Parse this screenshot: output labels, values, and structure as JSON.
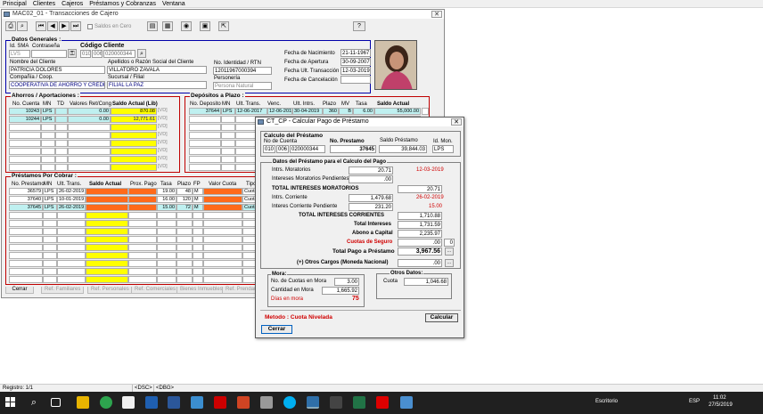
{
  "menu": [
    "Principal",
    "Clientes",
    "Cajeros",
    "Préstamos y Cobranzas",
    "Ventana"
  ],
  "main_window": {
    "title": "MAC02_01 - Transacciones de Cajero",
    "saldos_checkbox": "Saldos en Cero",
    "help_button": "?",
    "datos_generales": {
      "title": "Datos Generales :",
      "id_sma_label": "Id. SMA",
      "contrasena_label": "Contraseña",
      "id_sma_value": "LVS",
      "codigo_cliente_label": "Código Cliente",
      "codigo_parts": [
        "010",
        "006",
        "020000344"
      ],
      "nombre_label": "Nombre del Cliente",
      "nombre_value": "PATRICIA DOLORES",
      "apellidos_label": "Apellidos o Razón Social del Cliente",
      "apellidos_value": "VILLATORO ZAVALA",
      "identidad_label": "No. Identidad / RTN",
      "identidad_value": "12011967000394",
      "compania_label": "Compañía / Coop.",
      "compania_value": "COOPERATIVA DE AHORRO Y CRÉDITO",
      "sucursal_label": "Sucursal / Filial",
      "sucursal_value": "FILIAL LA PAZ",
      "personeria_label": "Personería",
      "personeria_value": "Persona Natural",
      "fecha_nacimiento_label": "Fecha de Nacimiento",
      "fecha_nacimiento": "21-11-1967",
      "fecha_apertura_label": "Fecha de Apertura",
      "fecha_apertura": "30-09-2007",
      "fecha_ult_label": "Fecha Ult. Transacción",
      "fecha_ult": "12-03-2019",
      "fecha_cancel_label": "Fecha de Cancelación",
      "fecha_cancel": ""
    },
    "ahorros": {
      "title": "Ahorros / Aportaciones :",
      "headers": [
        "No. Cuenta",
        "MN",
        "TD",
        "Valores Ret/Cong",
        "Saldo Actual (Lib)"
      ],
      "rows": [
        {
          "cuenta": "10243",
          "mn": "LPS",
          "td": "",
          "valores": "0.00",
          "saldo": "870.08",
          "vd": "[VD]"
        },
        {
          "cuenta": "10244",
          "mn": "LPS",
          "td": "",
          "valores": "0.00",
          "saldo": "12,771.61",
          "vd": "[VD]"
        }
      ],
      "vd": "[VD]"
    },
    "depositos": {
      "title": "Depósitos a Plazo :",
      "headers": [
        "No. Deposito",
        "MN",
        "Ult. Trans.",
        "Venc.",
        "Ult. Intrs.",
        "Plazo",
        "MV",
        "Tasa",
        "Saldo Actual"
      ],
      "rows": [
        {
          "dep": "37644",
          "mn": "LPS",
          "ult": "12-06-2017",
          "venc": "12-06-2019",
          "intrs": "30-04-2019",
          "plazo": "360",
          "mv": "B",
          "tasa": "6.00",
          "saldo": "55,000.00"
        }
      ]
    },
    "prestamos": {
      "title": "Préstamos Por Cobrar :",
      "headers": [
        "No. Prestamo",
        "MN",
        "Ult. Trans.",
        "Saldo Actual",
        "Prox. Pago",
        "Tasa",
        "Plazo",
        "FP",
        "Valor Cuota",
        "Tipo"
      ],
      "rows": [
        {
          "num": "36579",
          "mn": "LPS",
          "ult": "26-02-2019",
          "tasa": "19.00",
          "plazo": "48",
          "fp": "M",
          "tipo": "Cuota"
        },
        {
          "num": "37640",
          "mn": "LPS",
          "ult": "10-01-2019",
          "tasa": "16.00",
          "plazo": "120",
          "fp": "M",
          "tipo": "Cuota"
        },
        {
          "num": "37645",
          "mn": "LPS",
          "ult": "26-02-2019",
          "tasa": "15.00",
          "plazo": "72",
          "fp": "M",
          "tipo": "Cuota"
        }
      ]
    },
    "tabs": [
      "Cerrar",
      "Ref. Familiares",
      "Ref. Personales",
      "Ref. Comerciales",
      "Bienes Inmuebles",
      "Ref. Prendarias"
    ]
  },
  "dialog": {
    "title": "CT_CP - Calcular Pago de Préstamo",
    "calculo_title": "Calculo del Préstamo",
    "no_cuenta_label": "No de Cuenta",
    "no_cuenta_parts": [
      "010",
      "006",
      "020000344"
    ],
    "no_prestamo_label": "No. Prestamo",
    "no_prestamo": "37645",
    "saldo_prestamo_label": "Saldo Préstamo",
    "saldo_prestamo": "39,844.03",
    "id_mon_label": "Id. Mon.",
    "id_mon": "LPS",
    "datos_title": "Datos del Préstamo para el Calculo del Pago",
    "intrs_moratorios_label": "Intrs. Moratorios",
    "intrs_moratorios": "20.71",
    "intrs_moratorios_date": "12-03-2019",
    "intereses_mora_pend_label": "Intereses Moratorios Pendientes",
    "intereses_mora_pend": ".00",
    "total_int_mora_label": "TOTAL INTERESES MORATORIOS",
    "total_int_mora": "20.71",
    "intrs_corriente_label": "Intrs. Corriente",
    "intrs_corriente": "1,479.68",
    "intrs_corriente_date": "26-02-2019",
    "interes_corr_pend_label": "Interes Corriente Pendiente",
    "interes_corr_pend": "231.20",
    "interes_corr_pend_rate": "15.00",
    "total_int_corr_label": "TOTAL INTERESES CORRIENTES",
    "total_int_corr": "1,710.88",
    "total_intereses_label": "Total Intereses",
    "total_intereses": "1,731.59",
    "abono_capital_label": "Abono a Capital",
    "abono_capital": "2,235.97",
    "cuotas_seguro_label": "Cuotas de Seguro",
    "cuotas_seguro": ".00",
    "cuotas_seguro_count": "0",
    "total_pago_label": "Total Pago a Préstamo",
    "total_pago": "3,967.56",
    "otros_cargos_label": "(+) Otros Cargos (Moneda Nacional)",
    "otros_cargos": ".00",
    "mora_title": "Mora:",
    "no_cuotas_mora_label": "No. de Cuotas en Mora",
    "no_cuotas_mora": "3.00",
    "cantidad_mora_label": "Cantidad en Mora",
    "cantidad_mora": "1,665.92",
    "dias_mora_label": "Días en mora",
    "dias_mora": "75",
    "otros_datos_title": "Otros Datos:",
    "cuota_label": "Cuota",
    "cuota": "1,046.68",
    "metodo": "Metodo : Cuota Nivelada",
    "calcular_button": "Calcular",
    "cerrar_button": "Cerrar",
    "small_btn": "...",
    "dash": "-"
  },
  "statusbar": {
    "registro": "Registro: 1/1",
    "dsc": "<DSC>",
    "dbg": "<DBG>"
  },
  "taskbar": {
    "escritorio": "Escritorio",
    "lang": "ESP",
    "time": "11:02",
    "date": "27/5/2019"
  },
  "colors": {
    "yellow": "#ffff00",
    "orange": "#ff6a1a",
    "cyan": "#bff0f0",
    "red": "#c00000",
    "navy": "#000080"
  }
}
